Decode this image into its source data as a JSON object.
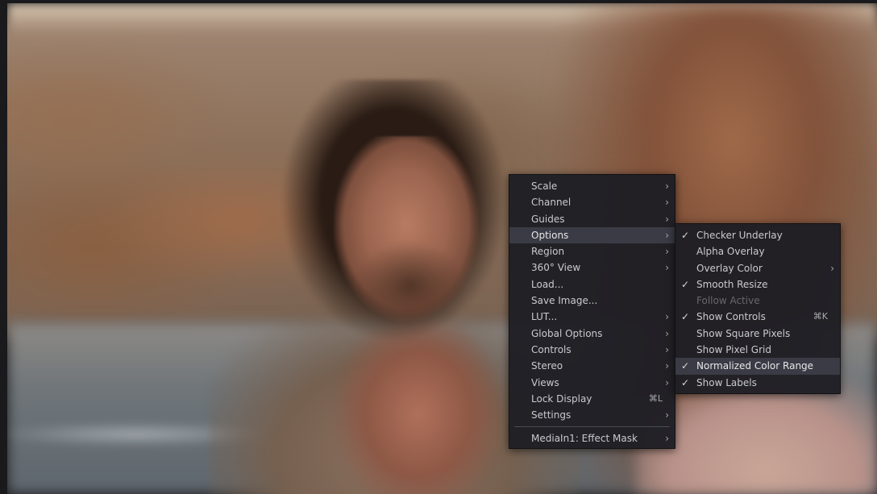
{
  "menu": {
    "items": [
      {
        "label": "Scale",
        "has_submenu": true,
        "icon": "chevron-right-icon"
      },
      {
        "label": "Channel",
        "has_submenu": true,
        "icon": "chevron-right-icon"
      },
      {
        "label": "Guides",
        "has_submenu": true,
        "icon": "chevron-right-icon"
      },
      {
        "label": "Options",
        "has_submenu": true,
        "active": true,
        "icon": "chevron-right-icon"
      },
      {
        "label": "Region",
        "has_submenu": true,
        "icon": "chevron-right-icon"
      },
      {
        "label": "360° View",
        "has_submenu": true,
        "icon": "chevron-right-icon"
      },
      {
        "label": "Load...",
        "has_submenu": false
      },
      {
        "label": "Save Image...",
        "has_submenu": false
      },
      {
        "label": "LUT...",
        "has_submenu": true,
        "icon": "chevron-right-icon"
      },
      {
        "label": "Global Options",
        "has_submenu": true,
        "icon": "chevron-right-icon"
      },
      {
        "label": "Controls",
        "has_submenu": true,
        "icon": "chevron-right-icon"
      },
      {
        "label": "Stereo",
        "has_submenu": true,
        "icon": "chevron-right-icon"
      },
      {
        "label": "Views",
        "has_submenu": true,
        "icon": "chevron-right-icon"
      },
      {
        "label": "Lock Display",
        "shortcut": "⌘L"
      },
      {
        "label": "Settings",
        "has_submenu": true,
        "icon": "chevron-right-icon"
      }
    ],
    "footer_item": {
      "label": "MediaIn1: Effect Mask",
      "has_submenu": true,
      "icon": "chevron-right-icon"
    }
  },
  "options_submenu": {
    "items": [
      {
        "label": "Checker Underlay",
        "checked": true
      },
      {
        "label": "Alpha Overlay",
        "checked": false
      },
      {
        "label": "Overlay Color",
        "checked": false,
        "has_submenu": true,
        "icon": "chevron-right-icon"
      },
      {
        "label": "Smooth Resize",
        "checked": true
      },
      {
        "label": "Follow Active",
        "checked": false,
        "disabled": true
      },
      {
        "label": "Show Controls",
        "checked": true,
        "shortcut": "⌘K"
      },
      {
        "label": "Show Square Pixels",
        "checked": false
      },
      {
        "label": "Show Pixel Grid",
        "checked": false
      },
      {
        "label": "Normalized Color Range",
        "checked": true,
        "active": true
      },
      {
        "label": "Show Labels",
        "checked": true
      }
    ]
  },
  "symbols": {
    "arrow": "›",
    "check": "✓"
  },
  "colors": {
    "menu_bg": "#1e1e24",
    "menu_highlight": "#3b3b45",
    "menu_text": "#c9cacf",
    "disabled_text": "#66676d"
  }
}
